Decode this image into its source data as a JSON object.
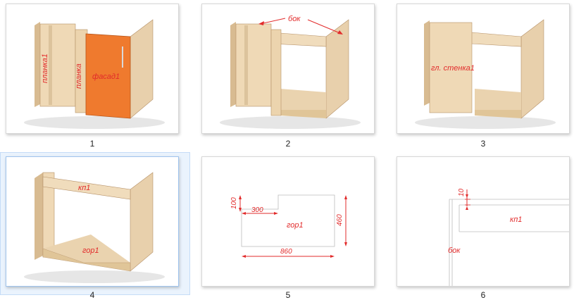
{
  "thumbnails": [
    {
      "caption": "1",
      "labels": {
        "planka1": "планка1",
        "planka": "планка",
        "facade": "фасад1"
      }
    },
    {
      "caption": "2",
      "labels": {
        "side": "бок"
      }
    },
    {
      "caption": "3",
      "labels": {
        "back_wall": "гл. стенка1"
      }
    },
    {
      "caption": "4",
      "labels": {
        "top_rail": "кп1",
        "bottom": "гор1"
      }
    },
    {
      "caption": "5",
      "labels": {
        "bottom": "гор1"
      },
      "dimensions": {
        "height_small": "100",
        "notch_width": "300",
        "depth": "460",
        "width": "860"
      }
    },
    {
      "caption": "6",
      "labels": {
        "top_rail": "кп1",
        "side": "бок"
      },
      "dimensions": {
        "offset": "10"
      }
    }
  ],
  "colors": {
    "wood_light": "#f0dcbc",
    "wood_mid": "#e2c79f",
    "wood_dark": "#c9a87b",
    "facade": "#f07a2e",
    "annotation": "#e22b2b",
    "selection": "#eaf3fd"
  }
}
